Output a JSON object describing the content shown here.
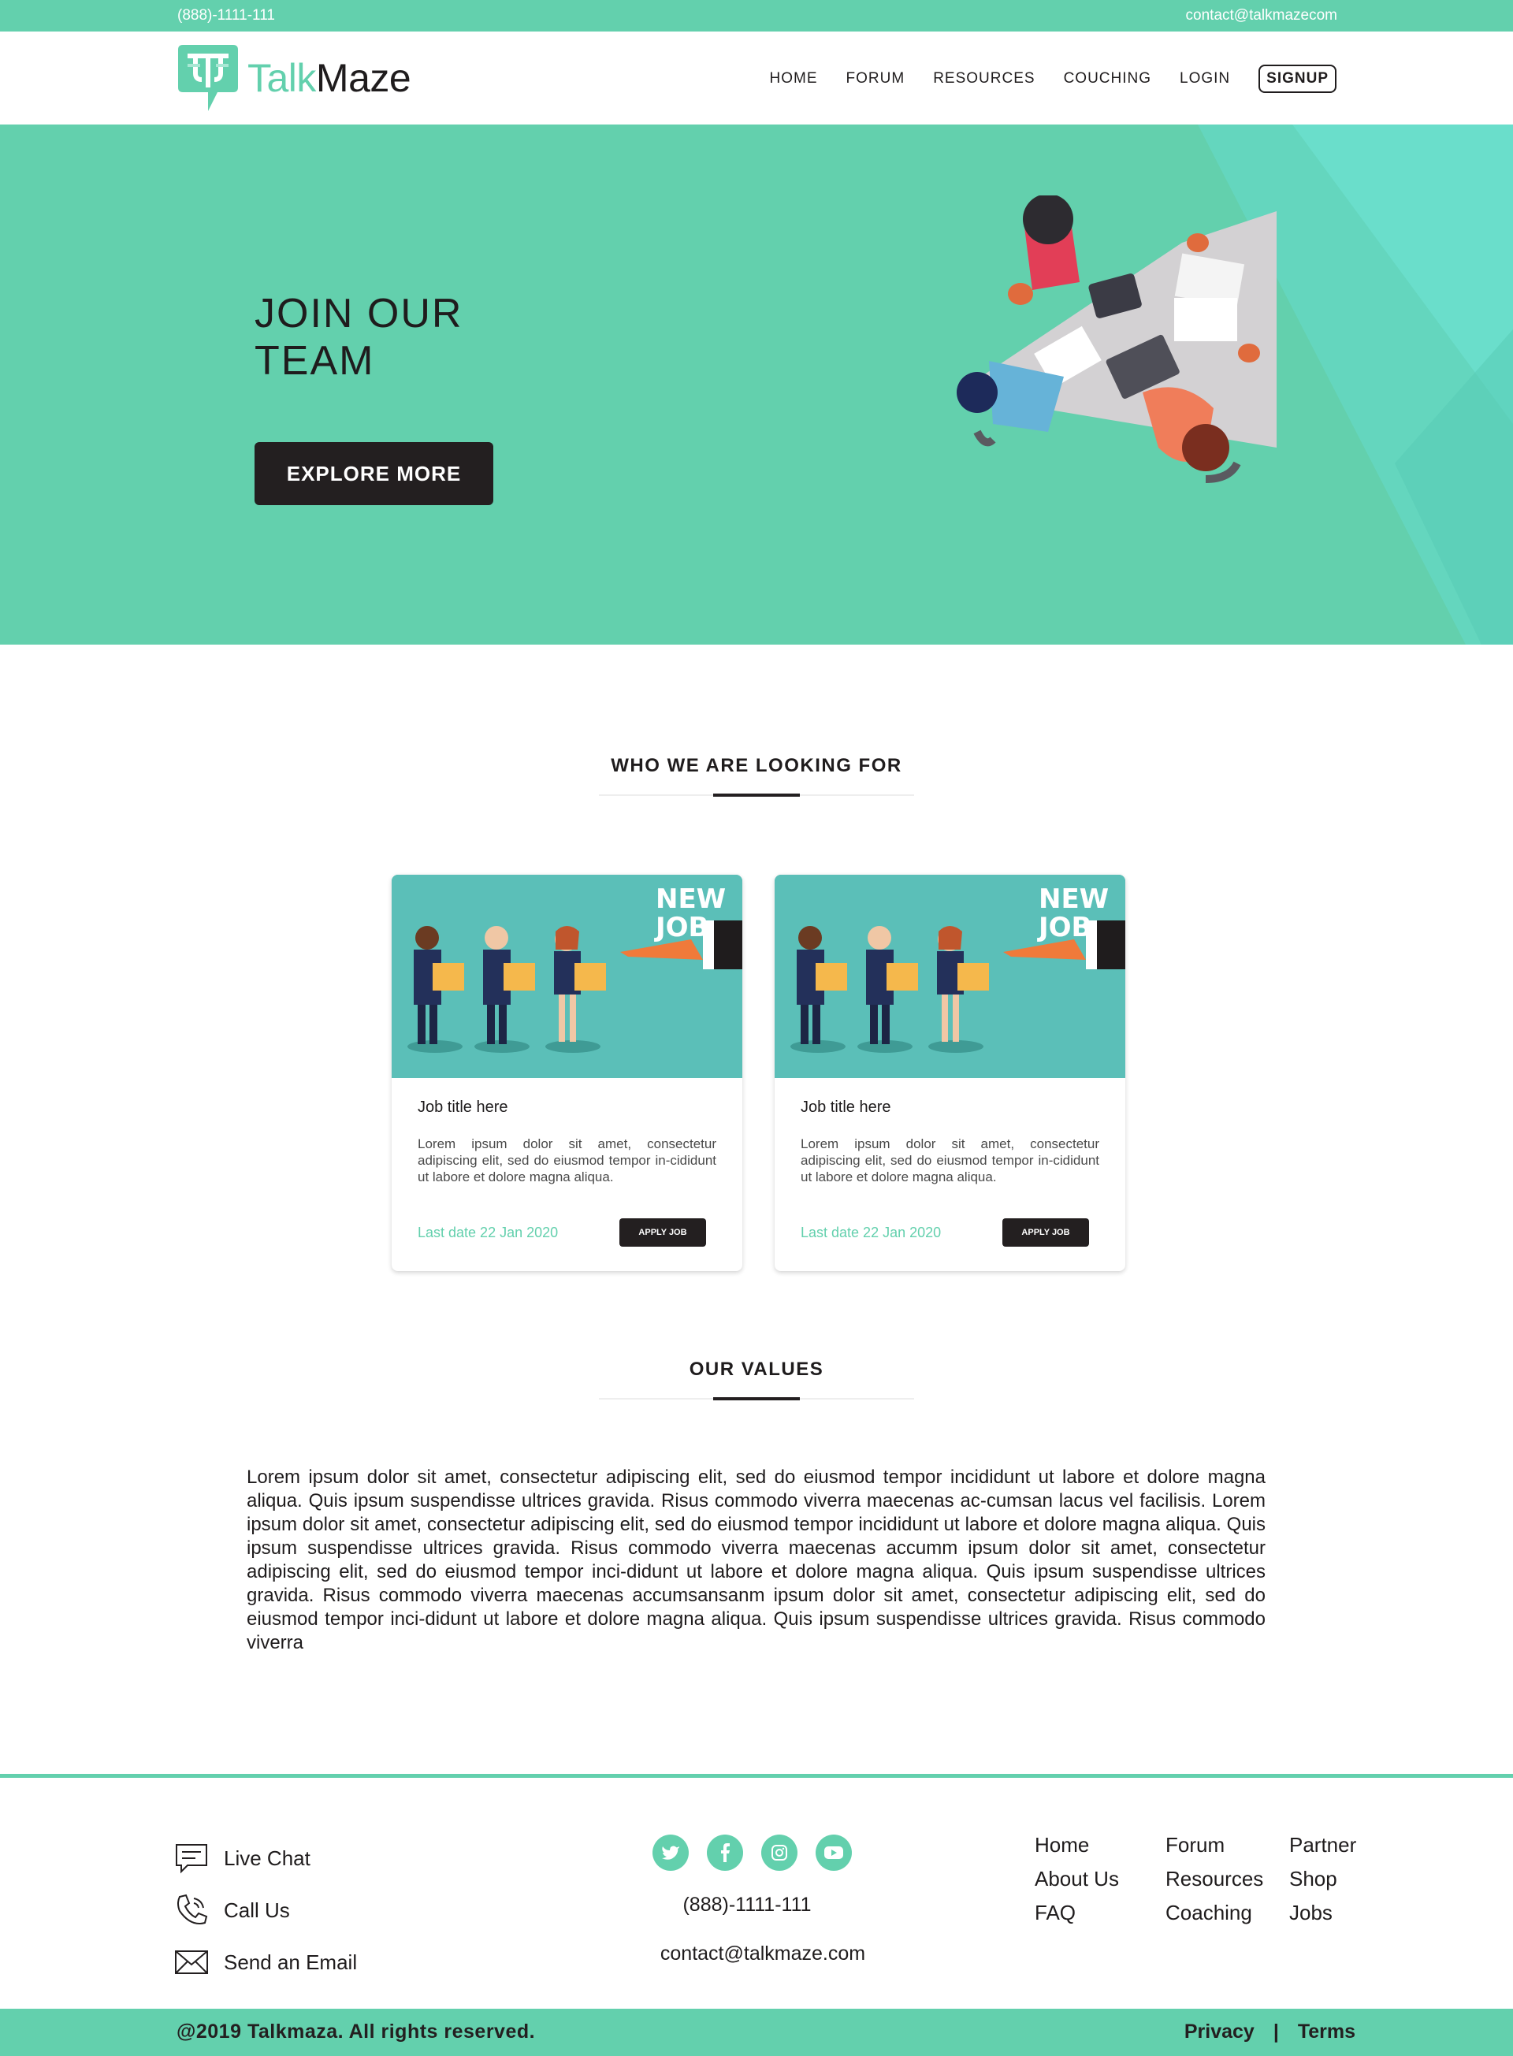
{
  "topbar": {
    "phone": "(888)-1111-111",
    "email": "contact@talkmazecom"
  },
  "brand": {
    "talk": "Talk",
    "maze": "Maze",
    "accent": "#63d0ad",
    "dark": "#231f20"
  },
  "nav": {
    "home": "HOME",
    "forum": "FORUM",
    "resources": "RESOURCES",
    "couching": "COUCHING",
    "login": "LOGIN",
    "signup": "SIGNUP"
  },
  "hero": {
    "title_line1": "JOIN OUR",
    "title_line2": "TEAM",
    "cta": "EXPLORE MORE"
  },
  "looking": {
    "heading": "WHO WE ARE LOOKING FOR"
  },
  "jobs": [
    {
      "image_badge_line1": "NEW",
      "image_badge_line2": "JOB",
      "title": "Job title here",
      "description": "Lorem ipsum dolor sit amet, consectetur adipiscing elit, sed do eiusmod tempor in-cididunt ut labore et dolore magna aliqua.",
      "date": "Last date 22 Jan 2020",
      "apply": "APPLY JOB"
    },
    {
      "image_badge_line1": "NEW",
      "image_badge_line2": "JOB",
      "title": "Job title here",
      "description": "Lorem ipsum dolor sit amet, consectetur adipiscing elit, sed do eiusmod tempor in-cididunt ut labore et dolore magna aliqua.",
      "date": "Last date 22 Jan 2020",
      "apply": "APPLY JOB"
    }
  ],
  "values": {
    "heading": "OUR VALUES",
    "text": "Lorem ipsum dolor sit amet, consectetur adipiscing elit, sed do eiusmod tempor incididunt ut labore et dolore magna aliqua. Quis ipsum suspendisse ultrices gravida. Risus commodo viverra maecenas ac-cumsan lacus vel facilisis. Lorem ipsum dolor sit amet, consectetur adipiscing elit, sed do eiusmod tempor incididunt ut labore et dolore magna aliqua. Quis ipsum suspendisse ultrices gravida. Risus commodo viverra maecenas accumm ipsum dolor sit amet, consectetur adipiscing elit, sed do eiusmod tempor inci-didunt ut labore et dolore magna aliqua. Quis ipsum suspendisse ultrices gravida. Risus commodo viverra maecenas accumsansanm ipsum dolor sit amet, consectetur adipiscing elit, sed do eiusmod tempor inci-didunt ut labore et dolore magna aliqua. Quis ipsum suspendisse ultrices gravida. Risus commodo viverra"
  },
  "footer": {
    "contact": {
      "live_chat": "Live Chat",
      "call_us": "Call Us",
      "send_email": "Send an Email"
    },
    "social_icons": [
      "twitter-icon",
      "facebook-icon",
      "instagram-icon",
      "youtube-icon"
    ],
    "phone": "(888)-1111-111",
    "email": "contact@talkmaze.com",
    "links_col1": {
      "a": "Home",
      "b": "About Us",
      "c": "FAQ"
    },
    "links_col2": {
      "a": "Forum",
      "b": "Resources",
      "c": "Coaching"
    },
    "links_col3": {
      "a": "Partner",
      "b": "Shop",
      "c": "Jobs"
    },
    "copyright": "@2019 Talkmaza. All rights reserved.",
    "privacy": "Privacy",
    "separator": "|",
    "terms": "Terms"
  }
}
